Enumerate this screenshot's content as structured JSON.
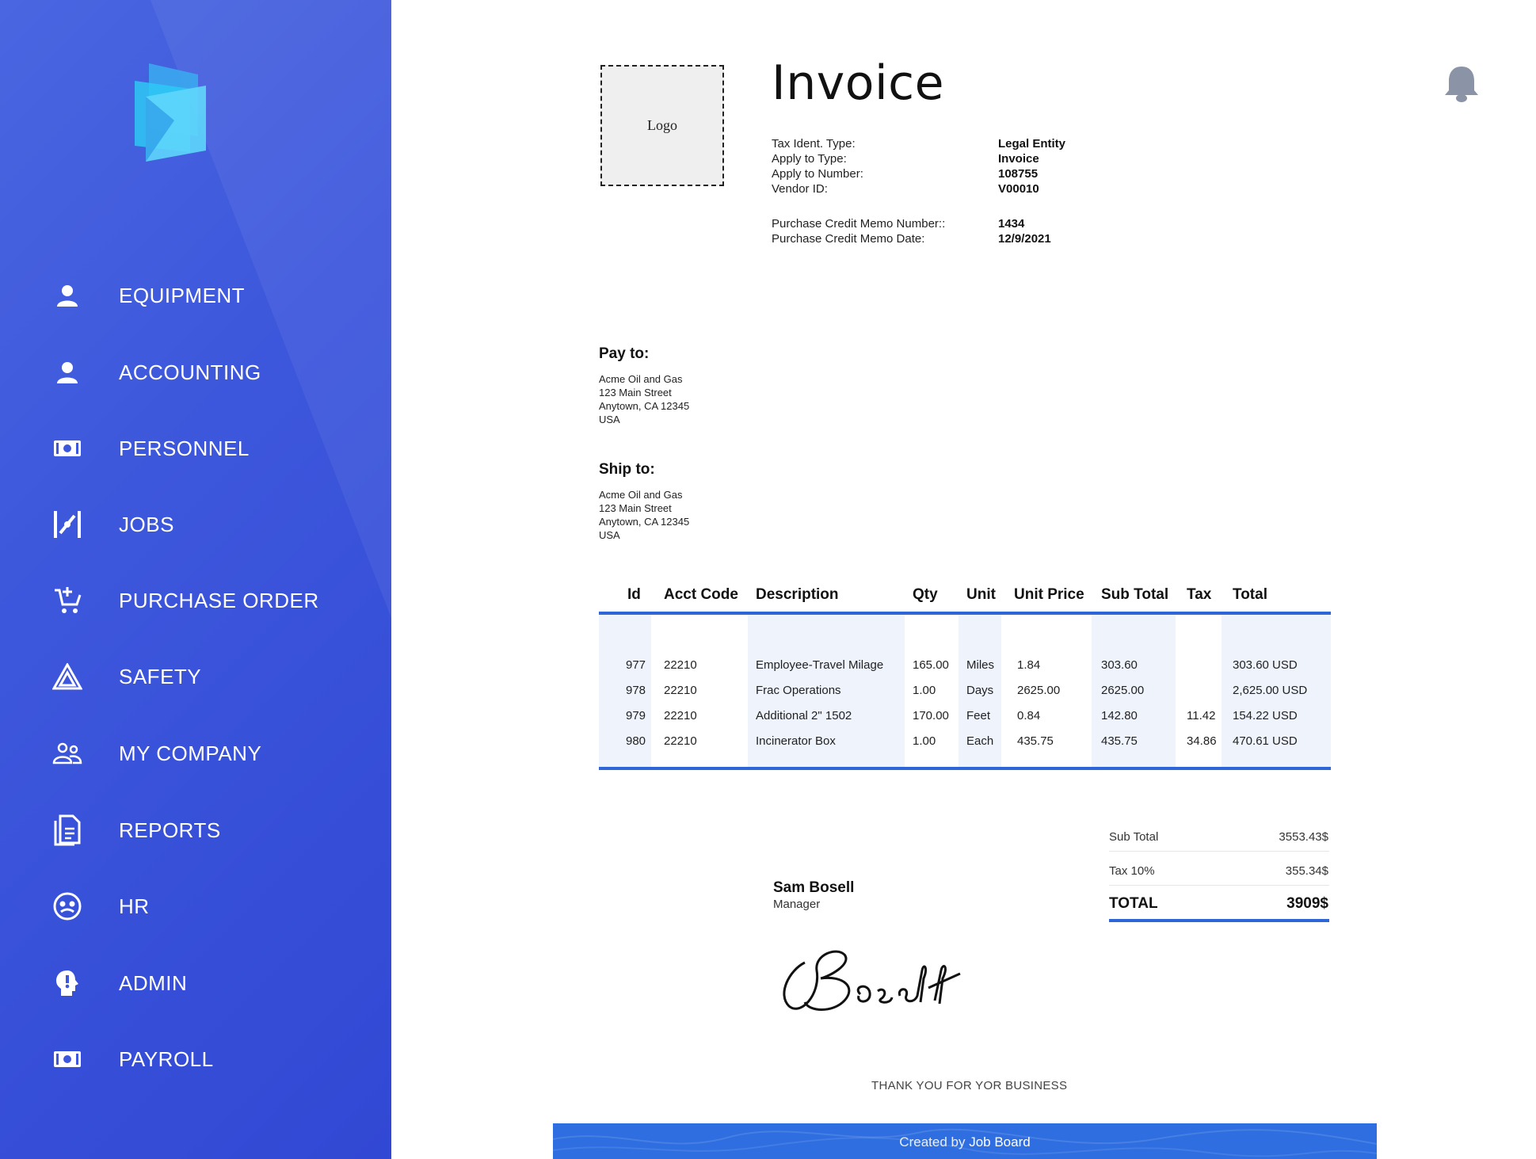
{
  "sidebar": {
    "items": [
      {
        "label": "EQUIPMENT",
        "icon": "person-icon"
      },
      {
        "label": "ACCOUNTING",
        "icon": "person-icon"
      },
      {
        "label": "PERSONNEL",
        "icon": "cash-icon"
      },
      {
        "label": "JOBS",
        "icon": "jobs-icon"
      },
      {
        "label": "PURCHASE ORDER",
        "icon": "cart-icon"
      },
      {
        "label": "SAFETY",
        "icon": "warning-triangle-icon"
      },
      {
        "label": "MY COMPANY",
        "icon": "group-icon"
      },
      {
        "label": "REPORTS",
        "icon": "document-icon"
      },
      {
        "label": "HR",
        "icon": "face-icon"
      },
      {
        "label": "ADMIN",
        "icon": "alert-head-icon"
      },
      {
        "label": "PAYROLL",
        "icon": "cash-icon"
      }
    ]
  },
  "invoice": {
    "logo_placeholder": "Logo",
    "title": "Invoice",
    "meta": [
      {
        "label": "Tax Ident. Type:",
        "value": "Legal Entity"
      },
      {
        "label": "Apply to Type:",
        "value": "Invoice"
      },
      {
        "label": "Apply to Number:",
        "value": "108755"
      },
      {
        "label": "Vendor ID:",
        "value": "V00010"
      }
    ],
    "memo": [
      {
        "label": "Purchase Credit Memo Number::",
        "value": "1434"
      },
      {
        "label": "Purchase Credit Memo Date:",
        "value": "12/9/2021"
      }
    ],
    "pay_to": {
      "heading": "Pay to:",
      "lines": [
        "Acme Oil and Gas",
        "123 Main Street",
        "Anytown, CA 12345",
        "USA"
      ]
    },
    "ship_to": {
      "heading": "Ship to:",
      "lines": [
        "Acme Oil and Gas",
        "123 Main Street",
        "Anytown, CA 12345",
        "USA"
      ]
    },
    "table": {
      "headers": [
        "Id",
        "Acct Code",
        "Description",
        "Qty",
        "Unit",
        "Unit Price",
        "Sub Total",
        "Tax",
        "Total"
      ],
      "rows": [
        [
          "977",
          "22210",
          "Employee-Travel Milage",
          "165.00",
          "Miles",
          "1.84",
          "303.60",
          "",
          "303.60 USD"
        ],
        [
          "978",
          "22210",
          "Frac Operations",
          "1.00",
          "Days",
          "2625.00",
          "2625.00",
          "",
          "2,625.00 USD"
        ],
        [
          "979",
          "22210",
          "Additional 2\" 1502",
          "170.00",
          "Feet",
          "0.84",
          "142.80",
          "11.42",
          "154.22 USD"
        ],
        [
          "980",
          "22210",
          "Incinerator Box",
          "1.00",
          "Each",
          "435.75",
          "435.75",
          "34.86",
          "470.61 USD"
        ]
      ]
    },
    "totals": {
      "sub_total_label": "Sub Total",
      "sub_total_value": "3553.43$",
      "tax_label": "Tax 10%",
      "tax_value": "355.34$",
      "total_label": "TOTAL",
      "total_value": "3909$"
    },
    "signer": {
      "name": "Sam Bosell",
      "role": "Manager",
      "signature_text": "Bosell"
    },
    "thanks": "THANK YOU FOR YOR BUSINESS",
    "footer": {
      "prefix": "Created by ",
      "brand": "Job Board"
    }
  },
  "colors": {
    "sidebar": "#3d57dc",
    "accent": "#2e65d8",
    "table_col_bg": "#eef3fc",
    "footer": "#2e6ee0"
  }
}
